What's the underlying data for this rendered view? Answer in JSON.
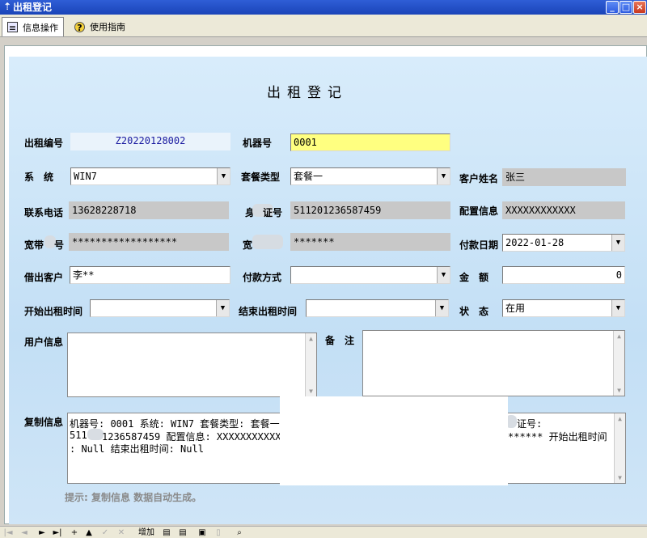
{
  "window": {
    "title": "出租登记"
  },
  "tabs": [
    {
      "label": "信息操作",
      "icon": "book-icon"
    },
    {
      "label": "使用指南",
      "icon": "help-icon"
    }
  ],
  "form": {
    "title": "出租登记",
    "fields": {
      "rental_no": {
        "label": "出租编号",
        "value": "Z20220128002"
      },
      "machine_no": {
        "label": "机器号",
        "value": "0001"
      },
      "system": {
        "label": "系　统",
        "value": "WIN7"
      },
      "package_type": {
        "label": "套餐类型",
        "value": "套餐一"
      },
      "customer_name": {
        "label": "客户姓名",
        "value": "张三"
      },
      "phone": {
        "label": "联系电话",
        "value": "13628228718"
      },
      "id_no": {
        "label_left": "身",
        "label_right": "证号",
        "value": "511201236587459"
      },
      "config_info": {
        "label": "配置信息",
        "value": "XXXXXXXXXXXX"
      },
      "broadband_account": {
        "label_left": "宽带",
        "label_right": "号",
        "value": "******************"
      },
      "broadband_pwd": {
        "label_left": "宽",
        "value": "*******"
      },
      "pay_date": {
        "label": "付款日期",
        "value": "2022-01-28"
      },
      "borrower": {
        "label": "借出客户",
        "value": "李**"
      },
      "pay_method": {
        "label": "付款方式",
        "value": ""
      },
      "amount": {
        "label": "金　额",
        "value": "0"
      },
      "start_time": {
        "label": "开始出租时间",
        "value": ""
      },
      "end_time": {
        "label": "结束出租时间",
        "value": ""
      },
      "status": {
        "label": "状　态",
        "value": "在用"
      },
      "user_info": {
        "label": "用户信息",
        "value": ""
      },
      "remark": {
        "label": "备　注",
        "value": ""
      },
      "copy_info": {
        "label": "复制信息",
        "line1a": "机器号: 0001  系统: WIN7  套餐类型: 套餐一",
        "line1b": "证号:",
        "line2a": "511",
        "line2b": "1236587459  配置信息: XXXXXXXXXXXX",
        "line2c": "******  开始出租时间",
        "line3": ":  Null  结束出租时间:  Null"
      }
    },
    "hint": "提示: 复制信息 数据自动生成。"
  },
  "toolbar": {
    "add_label": "增加"
  }
}
